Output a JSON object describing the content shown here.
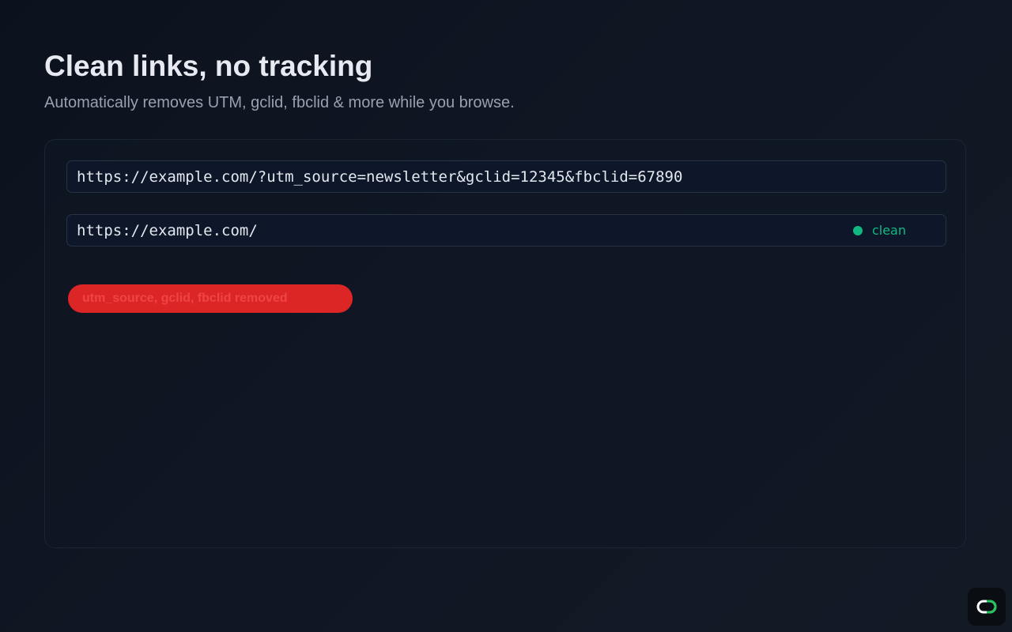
{
  "header": {
    "title": "Clean links, no tracking",
    "subtitle": "Automatically removes UTM, gclid, fbclid & more while you browse."
  },
  "demo": {
    "input_url": "https://example.com/?utm_source=newsletter&gclid=12345&fbclid=67890",
    "output_url": "https://example.com/",
    "status_label": "clean",
    "removed_label": "utm_source, gclid, fbclid removed"
  },
  "colors": {
    "status": "#10b981",
    "removed_badge": "#dc2626",
    "app_icon_accent": "#22c55e"
  },
  "icons": {
    "corner": "app-logo-icon"
  }
}
